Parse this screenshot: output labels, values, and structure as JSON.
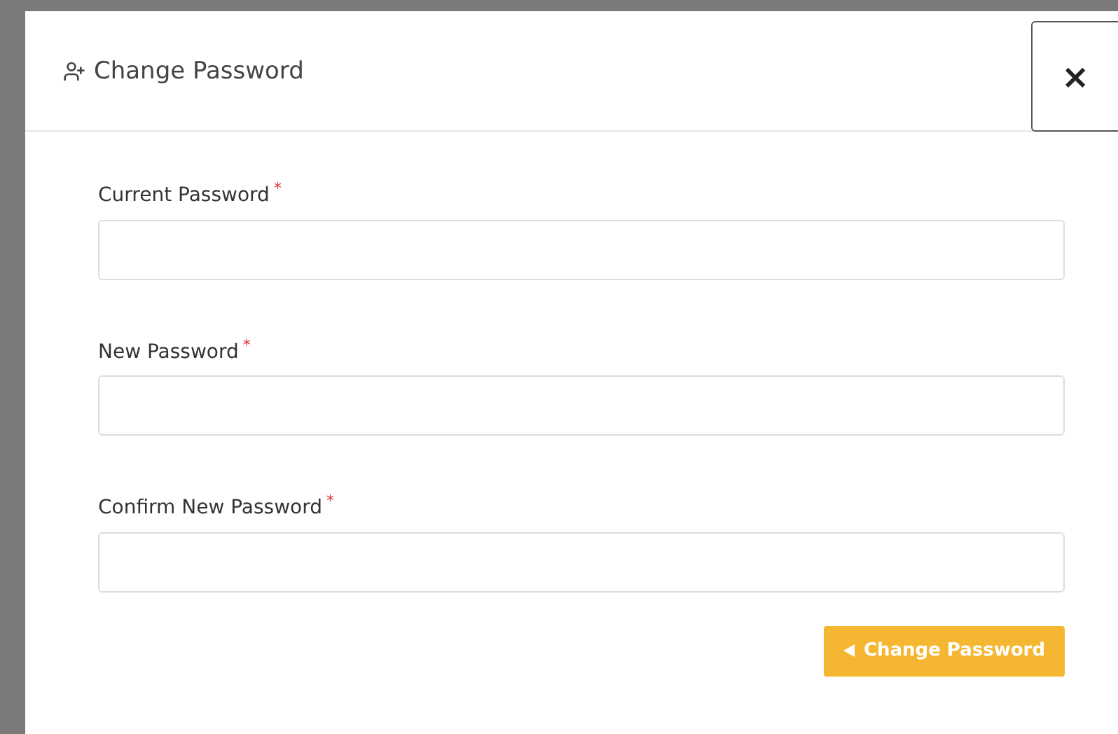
{
  "dialog": {
    "title": "Change Password",
    "close": "×"
  },
  "fields": [
    {
      "label": "Current Password",
      "required_mark": "*"
    },
    {
      "label": "New Password",
      "required_mark": "*"
    },
    {
      "label": "Confirm New Password",
      "required_mark": "*"
    }
  ],
  "submit_button": {
    "label": "Change Password"
  }
}
